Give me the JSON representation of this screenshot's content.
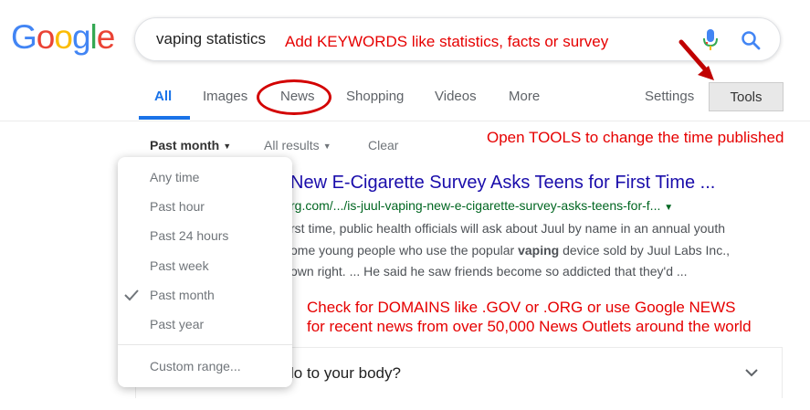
{
  "logo": {
    "letters": [
      "G",
      "o",
      "o",
      "g",
      "l",
      "e"
    ],
    "colors": [
      "#4285F4",
      "#EA4335",
      "#FBBC05",
      "#4285F4",
      "#34A853",
      "#EA4335"
    ]
  },
  "search": {
    "value": "vaping statistics"
  },
  "annotations": {
    "keywords": "Add KEYWORDS like statistics, facts or survey",
    "tools": "Open TOOLS to change the time published",
    "domains_line1": "Check for DOMAINS like .GOV or .ORG or use Google NEWS",
    "domains_line2": "for recent news from over 50,000 News Outlets around the world"
  },
  "nav": {
    "all": "All",
    "images": "Images",
    "news": "News",
    "shopping": "Shopping",
    "videos": "Videos",
    "more": "More",
    "settings": "Settings",
    "tools": "Tools"
  },
  "filters": {
    "time": "Past month",
    "results": "All results",
    "clear": "Clear"
  },
  "dropdown": {
    "items": [
      "Any time",
      "Past hour",
      "Past 24 hours",
      "Past week",
      "Past month",
      "Past year"
    ],
    "selected": "Past month",
    "custom": "Custom range..."
  },
  "result": {
    "title": "New E-Cigarette Survey Asks Teens for First Time ...",
    "url": "rg.com/.../is-juul-vaping-new-e-cigarette-survey-asks-teens-for-f...",
    "snippet_line1": "rst time, public health officials will ask about Juul by name in an annual youth",
    "snippet_line2_a": "ome young people who use the popular ",
    "snippet_line2_bold": "vaping",
    "snippet_line2_b": " device sold by Juul Labs Inc.,",
    "snippet_line3": "own right. ... He said he saw friends become so addicted that they'd ..."
  },
  "question": {
    "text": "lo to your body?"
  },
  "colors": {
    "accent": "#1a73e8",
    "annotation": "#e60000",
    "link": "#1a0dab",
    "url": "#006621"
  }
}
